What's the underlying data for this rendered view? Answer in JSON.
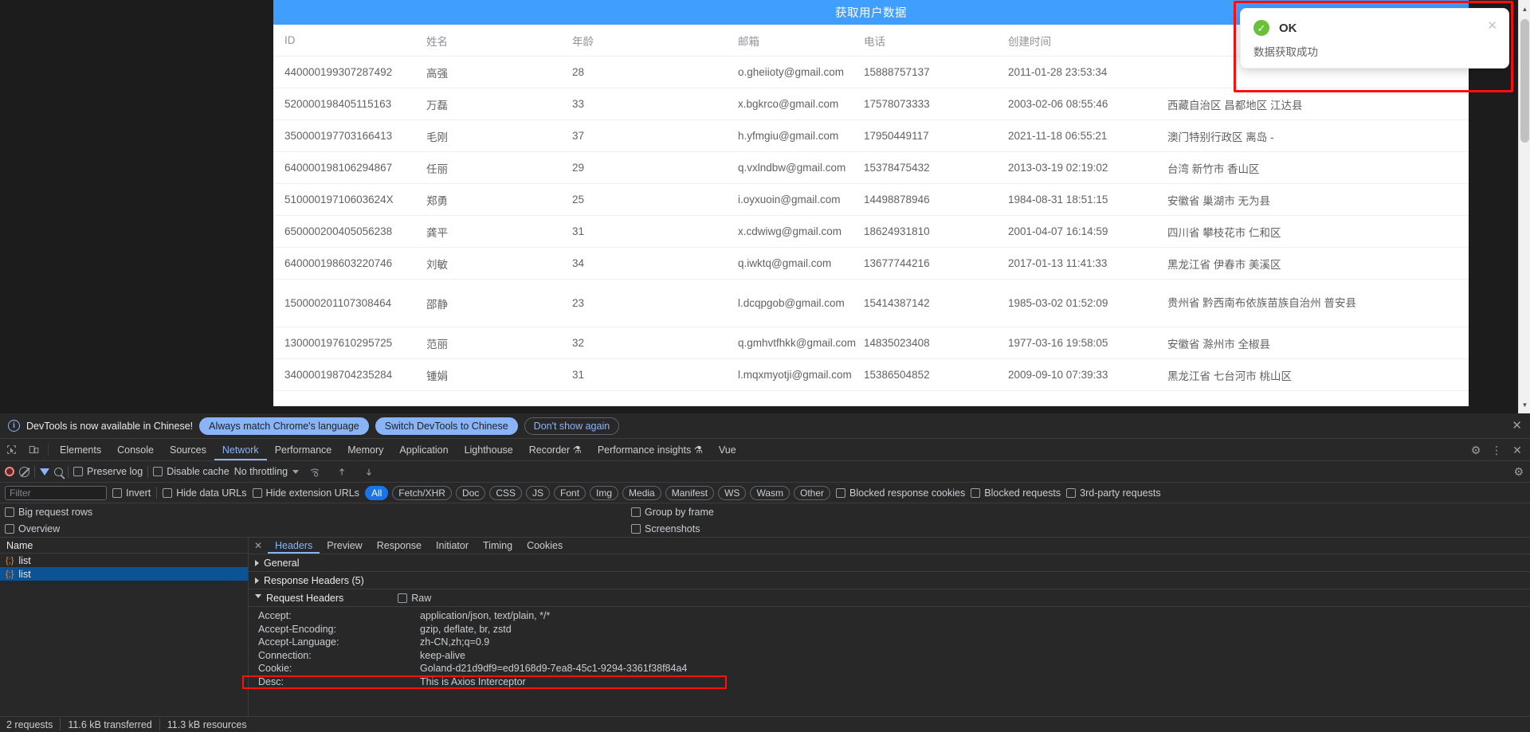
{
  "app": {
    "header_title": "获取用户数据",
    "header_bg": "#409eff"
  },
  "toast": {
    "title": "OK",
    "message": "数据获取成功",
    "close_label": "✕",
    "check_glyph": "✓",
    "success_color": "#67c23a",
    "highlight_color": "#ff0f0f"
  },
  "table": {
    "columns": [
      "ID",
      "姓名",
      "年龄",
      "邮箱",
      "电话",
      "创建时间",
      ""
    ],
    "rows": [
      {
        "id": "440000199307287492",
        "name": "高强",
        "age": "28",
        "email": "o.gheiioty@gmail.com",
        "phone": "15888757137",
        "created": "2011-01-28 23:53:34",
        "addr": ""
      },
      {
        "id": "520000198405115163",
        "name": "万磊",
        "age": "33",
        "email": "x.bgkrco@gmail.com",
        "phone": "17578073333",
        "created": "2003-02-06 08:55:46",
        "addr": "西藏自治区 昌都地区 江达县"
      },
      {
        "id": "350000197703166413",
        "name": "毛刚",
        "age": "37",
        "email": "h.yfmgiu@gmail.com",
        "phone": "17950449117",
        "created": "2021-11-18 06:55:21",
        "addr": "澳门特别行政区 离岛 -"
      },
      {
        "id": "640000198106294867",
        "name": "任丽",
        "age": "29",
        "email": "q.vxlndbw@gmail.com",
        "phone": "15378475432",
        "created": "2013-03-19 02:19:02",
        "addr": "台湾 新竹市 香山区"
      },
      {
        "id": "51000019710603624X",
        "name": "郑勇",
        "age": "25",
        "email": "i.oyxuoin@gmail.com",
        "phone": "14498878946",
        "created": "1984-08-31 18:51:15",
        "addr": "安徽省 巢湖市 无为县"
      },
      {
        "id": "650000200405056238",
        "name": "龚平",
        "age": "31",
        "email": "x.cdwiwg@gmail.com",
        "phone": "18624931810",
        "created": "2001-04-07 16:14:59",
        "addr": "四川省 攀枝花市 仁和区"
      },
      {
        "id": "640000198603220746",
        "name": "刘敏",
        "age": "34",
        "email": "q.iwktq@gmail.com",
        "phone": "13677744216",
        "created": "2017-01-13 11:41:33",
        "addr": "黑龙江省 伊春市 美溪区"
      },
      {
        "id": "150000201107308464",
        "name": "邵静",
        "age": "23",
        "email": "l.dcqpgob@gmail.com",
        "phone": "15414387142",
        "created": "1985-03-02 01:52:09",
        "addr": "贵州省 黔西南布依族苗族自治州 普安县",
        "tall": true
      },
      {
        "id": "130000197610295725",
        "name": "范丽",
        "age": "32",
        "email": "q.gmhvtfhkk@gmail.com",
        "phone": "14835023408",
        "created": "1977-03-16 19:58:05",
        "addr": "安徽省 滁州市 全椒县"
      },
      {
        "id": "340000198704235284",
        "name": "锺娟",
        "age": "31",
        "email": "l.mqxmyotji@gmail.com",
        "phone": "15386504852",
        "created": "2009-09-10 07:39:33",
        "addr": "黑龙江省 七台河市 桃山区"
      }
    ]
  },
  "devtools": {
    "banner": {
      "text": "DevTools is now available in Chinese!",
      "btn_always": "Always match Chrome's language",
      "btn_switch": "Switch DevTools to Chinese",
      "btn_dismiss": "Don't show again",
      "close": "✕"
    },
    "tabs": [
      {
        "label": "Elements",
        "active": false
      },
      {
        "label": "Console",
        "active": false
      },
      {
        "label": "Sources",
        "active": false
      },
      {
        "label": "Network",
        "active": true
      },
      {
        "label": "Performance",
        "active": false
      },
      {
        "label": "Memory",
        "active": false
      },
      {
        "label": "Application",
        "active": false
      },
      {
        "label": "Lighthouse",
        "active": false
      },
      {
        "label": "Recorder ⚗",
        "active": false
      },
      {
        "label": "Performance insights ⚗",
        "active": false
      },
      {
        "label": "Vue",
        "active": false
      }
    ],
    "tabs_right": [
      "⚙",
      "⋮",
      "✕"
    ],
    "toolbar": {
      "preserve_log": "Preserve log",
      "disable_cache": "Disable cache",
      "throttling": "No throttling",
      "settings_icon": "⚙"
    },
    "filterbar": {
      "filter_placeholder": "Filter",
      "invert": "Invert",
      "hide_data_urls": "Hide data URLs",
      "hide_ext_urls": "Hide extension URLs",
      "types": [
        {
          "label": "All",
          "selected": true
        },
        {
          "label": "Fetch/XHR",
          "selected": false
        },
        {
          "label": "Doc",
          "selected": false
        },
        {
          "label": "CSS",
          "selected": false
        },
        {
          "label": "JS",
          "selected": false
        },
        {
          "label": "Font",
          "selected": false
        },
        {
          "label": "Img",
          "selected": false
        },
        {
          "label": "Media",
          "selected": false
        },
        {
          "label": "Manifest",
          "selected": false
        },
        {
          "label": "WS",
          "selected": false
        },
        {
          "label": "Wasm",
          "selected": false
        },
        {
          "label": "Other",
          "selected": false
        }
      ],
      "blocked_response_cookies": "Blocked response cookies",
      "blocked_requests": "Blocked requests",
      "third_party": "3rd-party requests"
    },
    "options": {
      "big_request_rows": "Big request rows",
      "group_by_frame": "Group by frame",
      "overview": "Overview",
      "screenshots": "Screenshots"
    },
    "requests": {
      "column_name": "Name",
      "items": [
        {
          "name": "list",
          "selected": false
        },
        {
          "name": "list",
          "selected": true
        }
      ]
    },
    "detail": {
      "close": "✕",
      "tabs": [
        {
          "label": "Headers",
          "active": true
        },
        {
          "label": "Preview",
          "active": false
        },
        {
          "label": "Response",
          "active": false
        },
        {
          "label": "Initiator",
          "active": false
        },
        {
          "label": "Timing",
          "active": false
        },
        {
          "label": "Cookies",
          "active": false
        }
      ],
      "sections": [
        {
          "label": "General",
          "open": false
        },
        {
          "label": "Response Headers (5)",
          "open": false
        },
        {
          "label": "Request Headers",
          "open": true,
          "raw_label": "Raw"
        }
      ],
      "request_headers": [
        {
          "key": "Accept:",
          "value": "application/json, text/plain, */*"
        },
        {
          "key": "Accept-Encoding:",
          "value": "gzip, deflate, br, zstd"
        },
        {
          "key": "Accept-Language:",
          "value": "zh-CN,zh;q=0.9"
        },
        {
          "key": "Connection:",
          "value": "keep-alive"
        },
        {
          "key": "Cookie:",
          "value": "Goland-d21d9df9=ed9168d9-7ea8-45c1-9294-3361f38f84a4"
        },
        {
          "key": "Desc:",
          "value": "This is Axios Interceptor",
          "highlighted": true
        }
      ]
    },
    "status": {
      "requests": "2 requests",
      "transferred": "11.6 kB transferred",
      "resources": "11.3 kB resources"
    }
  }
}
